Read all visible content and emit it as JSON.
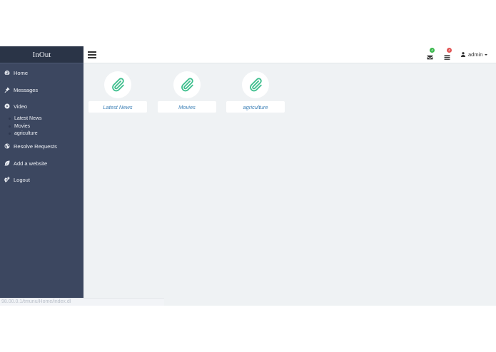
{
  "app": {
    "brand": "InOut"
  },
  "sidebar": {
    "items": [
      {
        "label": "Home",
        "icon": "dashboard-icon"
      },
      {
        "label": "Messages",
        "icon": "gavel-icon"
      },
      {
        "label": "Video",
        "icon": "video-circle-icon"
      },
      {
        "label": "Resolve Requests",
        "icon": "globe-icon"
      },
      {
        "label": "Add a website",
        "icon": "leaf-icon"
      },
      {
        "label": "Logout",
        "icon": "cogs-icon"
      }
    ],
    "video_subitems": [
      {
        "label": "Latest News"
      },
      {
        "label": "Movies"
      },
      {
        "label": "agriculture"
      }
    ]
  },
  "topbar": {
    "menu_icon": "hamburger-icon",
    "mail_badge": {
      "icon": "envelope-icon",
      "count": "4",
      "color": "#3cb84e"
    },
    "tasks_badge": {
      "icon": "list-icon",
      "count": "4",
      "color": "#e25454"
    },
    "user": {
      "icon": "user-icon",
      "name": "admin"
    }
  },
  "tiles": [
    {
      "label": "Latest News",
      "icon": "paperclip-icon"
    },
    {
      "label": "Movies",
      "icon": "paperclip-icon"
    },
    {
      "label": "agriculture",
      "icon": "paperclip-icon"
    }
  ],
  "statusbar": {
    "text": "98.00.0.1/tmunu/Home/index.dl"
  },
  "colors": {
    "sidebar": "#3c4760",
    "brand_bar": "#2a3447",
    "content_bg": "#eff2f4",
    "tile_icon": "#3fbf8e",
    "tile_label": "#3b7fb6"
  }
}
